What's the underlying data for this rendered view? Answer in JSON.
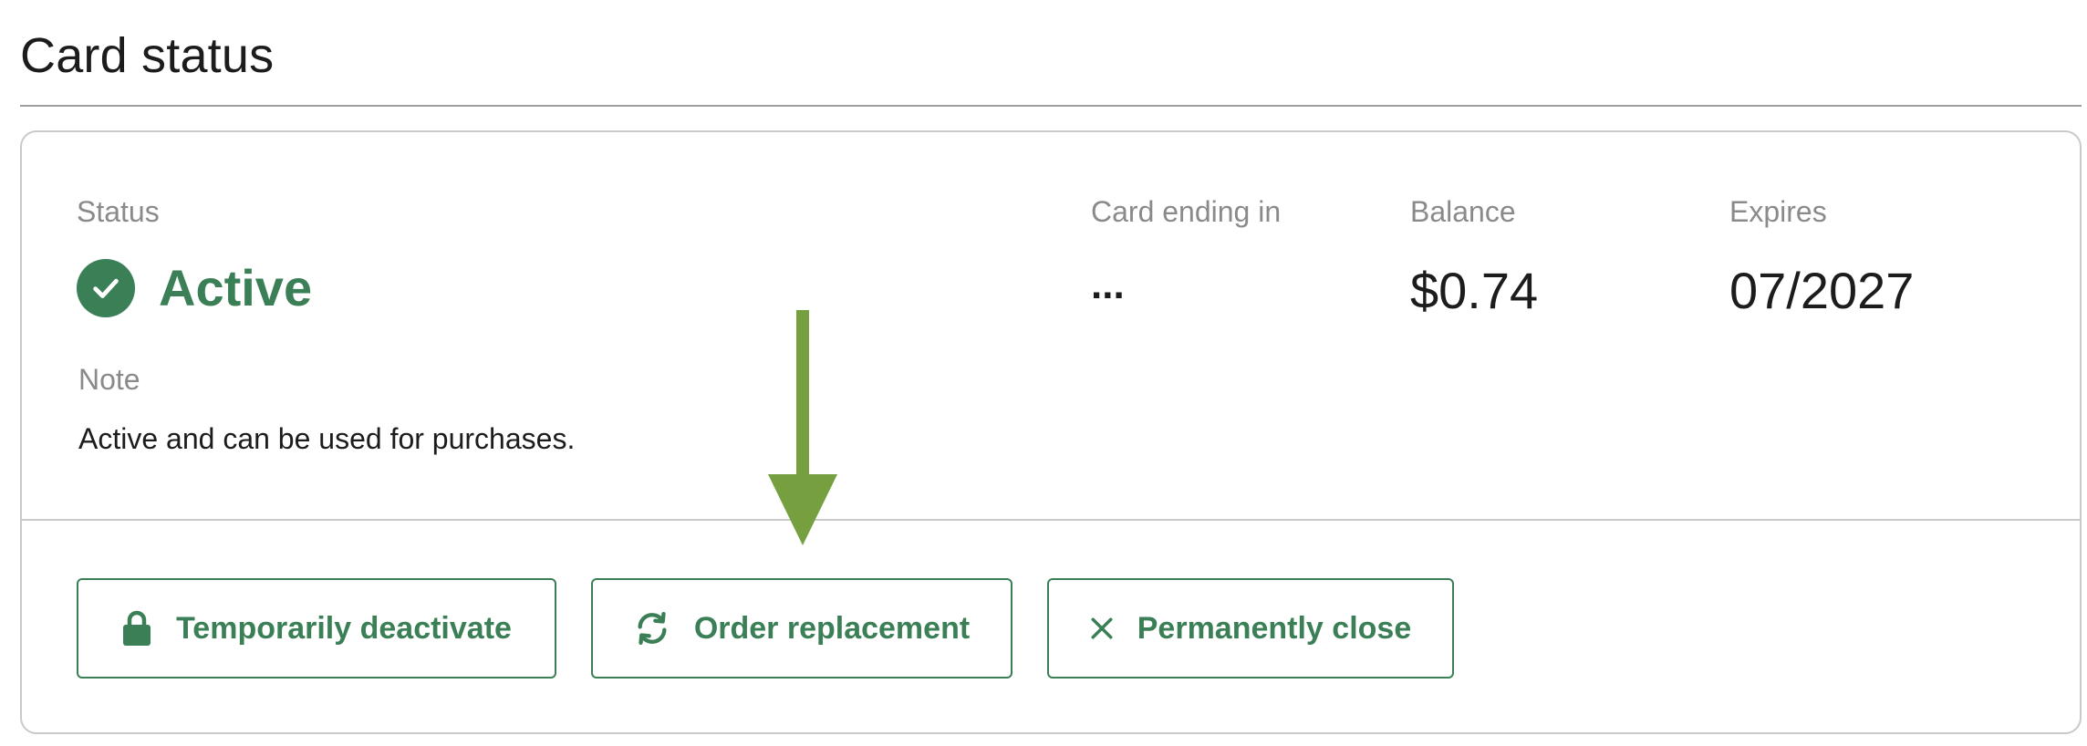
{
  "page": {
    "title": "Card status"
  },
  "card": {
    "status_label": "Status",
    "status_value": "Active",
    "card_ending_label": "Card ending in",
    "card_ending_value": "...",
    "balance_label": "Balance",
    "balance_value": "$0.74",
    "expires_label": "Expires",
    "expires_value": "07/2027",
    "note_label": "Note",
    "note_value": "Active and can be used for purchases."
  },
  "actions": {
    "deactivate_label": "Temporarily deactivate",
    "deactivate_icon": "lock-icon",
    "replace_label": "Order replacement",
    "replace_icon": "refresh-icon",
    "close_label": "Permanently close",
    "close_icon": "close-icon"
  },
  "colors": {
    "accent_green": "#3a7f56",
    "arrow_green": "#76a03f",
    "label_gray": "#8a8a8a",
    "border_gray": "#c9c9c9"
  }
}
